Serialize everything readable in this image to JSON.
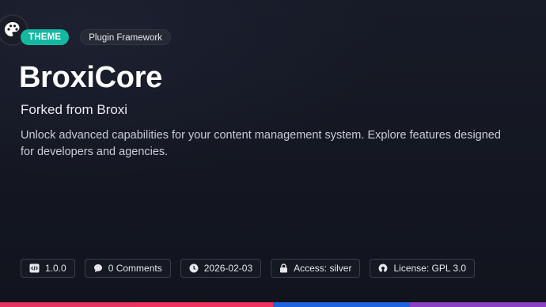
{
  "header": {
    "logo_icon": "palette-icon",
    "type_badge": "THEME",
    "category_badge": "Plugin Framework"
  },
  "title": "BroxiCore",
  "subtitle": "Forked from Broxi",
  "description": "Unlock advanced capabilities for your content management system. Explore features designed for developers and agencies.",
  "meta": {
    "version": "1.0.0",
    "comments": "0 Comments",
    "date": "2026-02-03",
    "access": "Access: silver",
    "license": "License: GPL 3.0"
  },
  "colors": {
    "accent": "#14b8a0",
    "bar": [
      "#e8325f",
      "#f0315e",
      "#1d63e0",
      "#8a3fc4"
    ]
  }
}
